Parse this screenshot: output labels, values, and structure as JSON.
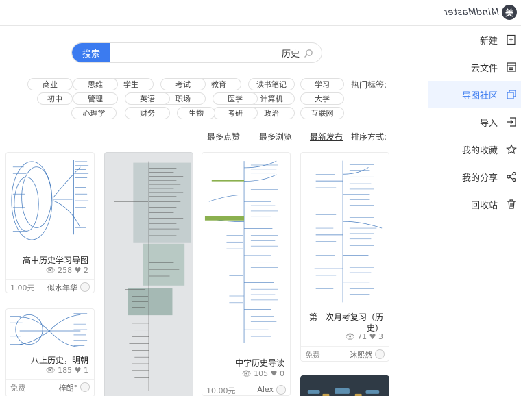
{
  "app": {
    "brand": "MindMaster",
    "logo_glyph": "美"
  },
  "sidebar": {
    "items": [
      {
        "label": "新建",
        "icon": "new-file-icon"
      },
      {
        "label": "云文件",
        "icon": "cloud-file-icon"
      },
      {
        "label": "导图社区",
        "icon": "community-icon",
        "active": true
      },
      {
        "label": "导入",
        "icon": "import-icon"
      },
      {
        "label": "我的收藏",
        "icon": "star-icon"
      },
      {
        "label": "我的分享",
        "icon": "share-icon"
      },
      {
        "label": "回收站",
        "icon": "trash-icon"
      }
    ]
  },
  "search": {
    "button": "搜索",
    "value": "历史"
  },
  "tags": {
    "label": "热门标签:",
    "row1": [
      "学习",
      "读书笔记",
      "教育",
      "考试",
      "学生",
      "思维",
      "商业"
    ],
    "row2": [
      "大学",
      "计算机",
      "医学",
      "职场",
      "英语",
      "管理",
      "初中"
    ],
    "row3": [
      "互联网",
      "政治",
      "考研",
      "生物",
      "财务",
      "心理学"
    ]
  },
  "sort": {
    "label": "排序方式:",
    "options": [
      "最新发布",
      "最多浏览",
      "最多点赞"
    ]
  },
  "cards": [
    {
      "title": "高中历史学习导图",
      "views": "258",
      "likes": "2",
      "author": "似水年华",
      "price": "1.00元"
    },
    {
      "title": "八上历史，明朝",
      "views": "185",
      "likes": "1",
      "author": "梓朗°",
      "price": "免费"
    },
    {
      "title": "中学历史导读",
      "views": "105",
      "likes": "0",
      "author": "Alex",
      "price": "10.00元"
    },
    {
      "title": "第一次月考复习（历史）",
      "views": "71",
      "likes": "3",
      "author": "沐熙然",
      "price": "免费"
    }
  ],
  "colors": {
    "accent": "#3b7bf0",
    "active_bg": "#eef4ff"
  }
}
